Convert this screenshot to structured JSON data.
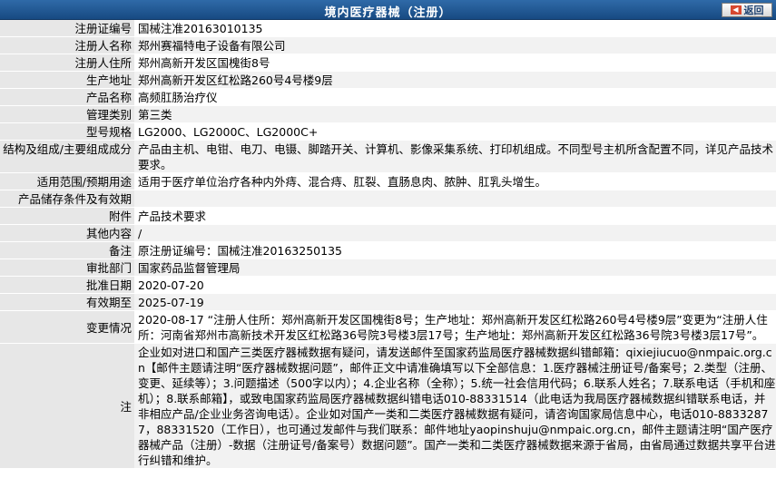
{
  "header": {
    "title": "境内医疗器械（注册）",
    "back_label": "返回",
    "back_icon": "arrow-left-icon"
  },
  "rows": [
    {
      "label": "注册证编号",
      "value": "国械注准20163010135"
    },
    {
      "label": "注册人名称",
      "value": "郑州赛福特电子设备有限公司"
    },
    {
      "label": "注册人住所",
      "value": "郑州高新开发区国槐街8号"
    },
    {
      "label": "生产地址",
      "value": "郑州高新开发区红松路260号4号楼9层"
    },
    {
      "label": "产品名称",
      "value": "高频肛肠治疗仪"
    },
    {
      "label": "管理类别",
      "value": "第三类"
    },
    {
      "label": "型号规格",
      "value": "LG2000、LG2000C、LG2000C+"
    },
    {
      "label": "结构及组成/主要组成成分",
      "value": "产品由主机、电钳、电刀、电镊、脚踏开关、计算机、影像采集系统、打印机组成。不同型号主机所含配置不同，详见产品技术要求。"
    },
    {
      "label": "适用范围/预期用途",
      "value": "适用于医疗单位治疗各种内外痔、混合痔、肛裂、直肠息肉、脓肿、肛乳头增生。"
    },
    {
      "label": "产品储存条件及有效期",
      "value": ""
    },
    {
      "label": "附件",
      "value": "产品技术要求"
    },
    {
      "label": "其他内容",
      "value": "/"
    },
    {
      "label": "备注",
      "value": "原注册证编号：国械注准20163250135"
    },
    {
      "label": "审批部门",
      "value": "国家药品监督管理局"
    },
    {
      "label": "批准日期",
      "value": "2020-07-20"
    },
    {
      "label": "有效期至",
      "value": "2025-07-19"
    },
    {
      "label": "变更情况",
      "value": "2020-08-17 “注册人住所：郑州高新开发区国槐街8号；生产地址：郑州高新开发区红松路260号4号楼9层”变更为“注册人住所：河南省郑州市高新技术开发区红松路36号院3号楼3层17号；生产地址：郑州高新开发区红松路36号院3号楼3层17号”。"
    },
    {
      "label": "注",
      "value": "企业如对进口和国产三类医疗器械数据有疑问，请发送邮件至国家药监局医疗器械数据纠错邮箱：qixiejiucuo@nmpaic.org.cn【邮件主题请注明“医疗器械数据问题”，邮件正文中请准确填写以下全部信息：1.医疗器械注册证号/备案号；2.类型（注册、变更、延续等）；3.问题描述（500字以内）；4.企业名称（全称）；5.统一社会信用代码；6.联系人姓名；7.联系电话（手机和座机）；8.联系邮箱】，或致电国家药监局医疗器械数据纠错电话010-88331514（此电话为我局医疗器械数据纠错联系电话，并非相应产品/企业业务咨询电话）。企业如对国产一类和二类医疗器械数据有疑问，请咨询国家局信息中心，电话010-88332877，88331520（工作日），也可通过发邮件与我们联系：邮件地址yaopinshuju@nmpaic.org.cn，邮件主题请注明“国产医疗器械产品（注册）-数据（注册证号/备案号）数据问题”。国产一类和二类医疗器械数据来源于省局，由省局通过数据共享平台进行纠错和维护。"
    }
  ]
}
